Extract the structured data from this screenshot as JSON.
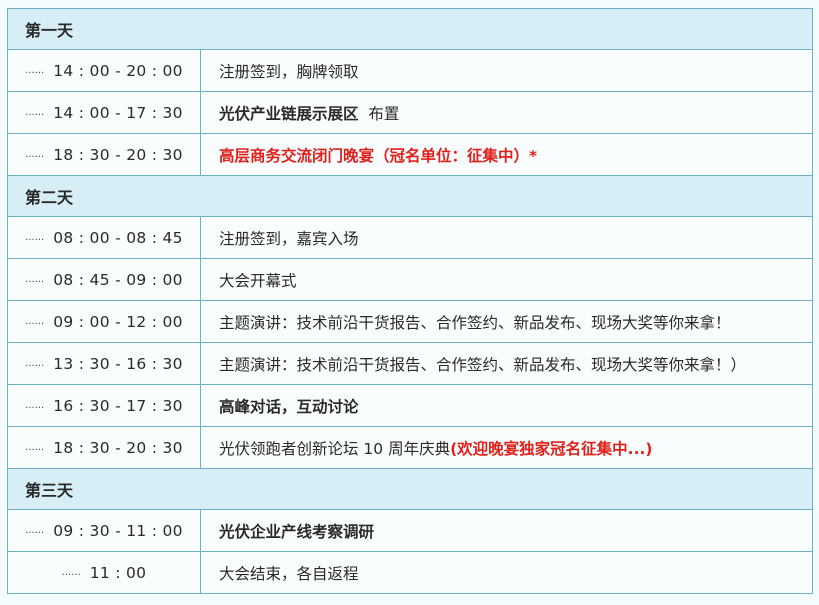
{
  "days": [
    {
      "label": "第一天",
      "items": [
        {
          "time": "14 : 00 - 20 : 00",
          "text": "注册签到，胸牌领取"
        },
        {
          "time": "14 : 00 - 17 : 30",
          "bold": "光伏产业链展示展区",
          "text": "布置"
        },
        {
          "time": "18 : 30 - 20 : 30",
          "red": "高层商务交流闭门晚宴（冠名单位：征集中）*"
        }
      ]
    },
    {
      "label": "第二天",
      "items": [
        {
          "time": "08 : 00 - 08 : 45",
          "text": "注册签到，嘉宾入场"
        },
        {
          "time": "08 : 45 - 09 : 00",
          "text": "大会开幕式"
        },
        {
          "time": "09 : 00 - 12 : 00",
          "text": "主题演讲：技术前沿干货报告、合作签约、新品发布、现场大奖等你来拿！"
        },
        {
          "time": "13 : 30 - 16 : 30",
          "text": "主题演讲：技术前沿干货报告、合作签约、新品发布、现场大奖等你来拿！）"
        },
        {
          "time": "16 : 30 - 17 : 30",
          "bold": "高峰对话，互动讨论"
        },
        {
          "time": "18 : 30 - 20 : 30",
          "text": "光伏领跑者创新论坛 10 周年庆典",
          "red": "(欢迎晚宴独家冠名征集中...)"
        }
      ]
    },
    {
      "label": "第三天",
      "items": [
        {
          "time": "09 : 30 - 11 : 00",
          "bold": "光伏企业产线考察调研"
        },
        {
          "time": "11 : 00",
          "text": "大会结束，各自返程"
        }
      ]
    }
  ],
  "dots": "······",
  "colors": {
    "header_bg": "#d7eef6",
    "border": "#6fb0c9",
    "highlight_red": "#e0211b",
    "page_bg": "#f3fbfd"
  }
}
